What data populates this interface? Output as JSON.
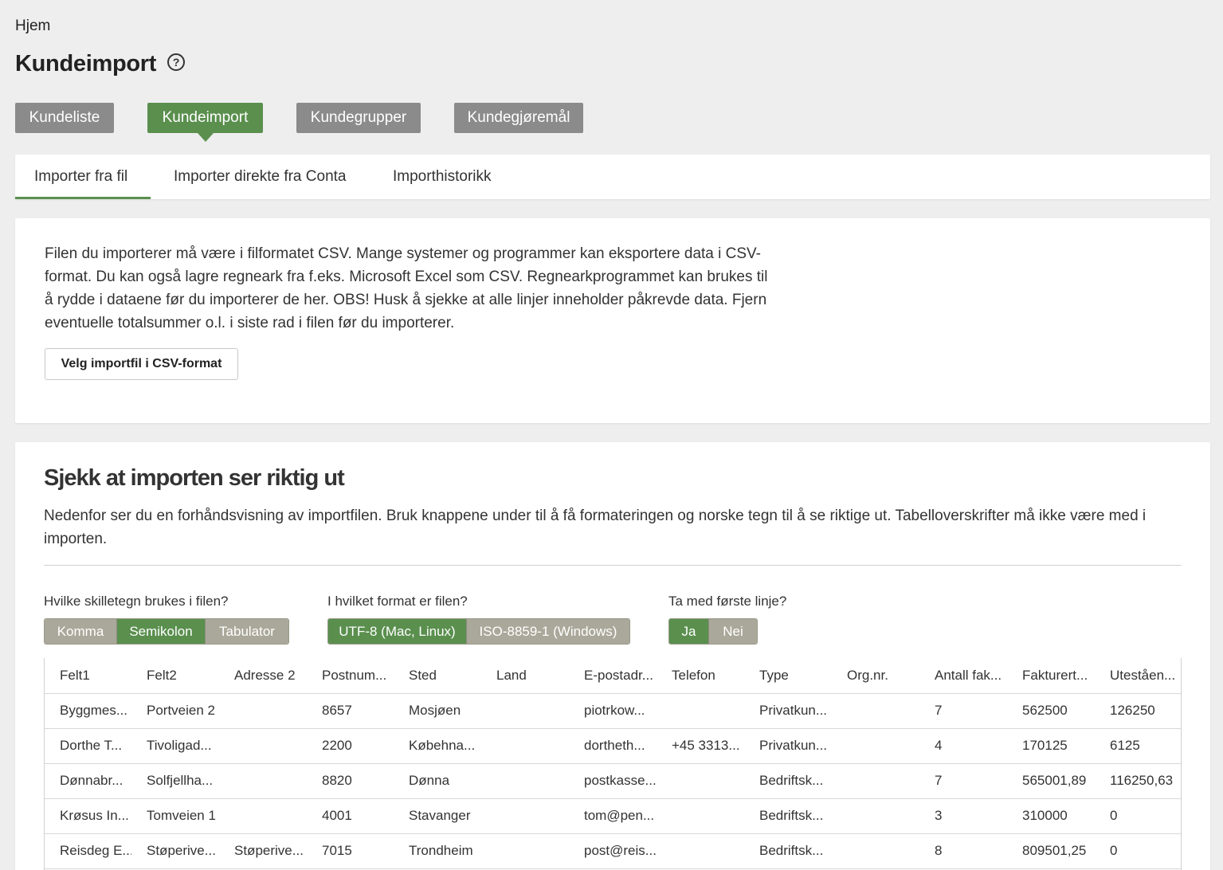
{
  "breadcrumb": "Hjem",
  "page_title": "Kundeimport",
  "help_glyph": "?",
  "main_nav": [
    "Kundeliste",
    "Kundeimport",
    "Kundegrupper",
    "Kundegjøremål"
  ],
  "sub_tabs": [
    "Importer fra fil",
    "Importer direkte fra Conta",
    "Importhistorikk"
  ],
  "intro": {
    "text": "Filen du importerer må være i filformatet CSV. Mange systemer og programmer kan eksportere data i CSV-format. Du kan også lagre regneark fra f.eks. Microsoft Excel som CSV. Regnearkprogrammet kan brukes til å rydde i dataene før du importerer de her. OBS! Husk å sjekke at alle linjer inneholder påkrevde data. Fjern eventuelle totalsummer o.l. i siste rad i filen før du importerer.",
    "button": "Velg importfil i CSV-format"
  },
  "preview": {
    "title": "Sjekk at importen ser riktig ut",
    "description": "Nedenfor ser du en forhåndsvisning av importfilen. Bruk knappene under til å få formateringen og norske tegn til å se riktige ut. Tabelloverskrifter må ikke være med i importen.",
    "separator_label": "Hvilke skilletegn brukes i filen?",
    "separator_options": [
      "Komma",
      "Semikolon",
      "Tabulator"
    ],
    "separator_selected": "Semikolon",
    "format_label": "I hvilket format er filen?",
    "format_options": [
      "UTF-8 (Mac, Linux)",
      "ISO-8859-1 (Windows)"
    ],
    "format_selected": "UTF-8 (Mac, Linux)",
    "first_line_label": "Ta med første linje?",
    "first_line_options": [
      "Ja",
      "Nei"
    ],
    "first_line_selected": "Ja",
    "columns": [
      "Felt1",
      "Felt2",
      "Adresse 2",
      "Postnum...",
      "Sted",
      "Land",
      "E-postadr...",
      "Telefon",
      "Type",
      "Org.nr.",
      "Antall fak...",
      "Fakturert...",
      "Uteståen..."
    ],
    "rows": [
      [
        "Byggmes...",
        "Portveien 2",
        "",
        "8657",
        "Mosjøen",
        "",
        "piotrkow...",
        "",
        "Privatkun...",
        "",
        "7",
        "562500",
        "126250"
      ],
      [
        "Dorthe T...",
        "Tivoligad...",
        "",
        "2200",
        "Købehna...",
        "",
        "dortheth...",
        "+45 3313...",
        "Privatkun...",
        "",
        "4",
        "170125",
        "6125"
      ],
      [
        "Dønnabr...",
        "Solfjellha...",
        "",
        "8820",
        "Dønna",
        "",
        "postkasse...",
        "",
        "Bedriftsk...",
        "",
        "7",
        "565001,89",
        "116250,63"
      ],
      [
        "Krøsus In...",
        "Tomveien 1",
        "",
        "4001",
        "Stavanger",
        "",
        "tom@pen...",
        "",
        "Bedriftsk...",
        "",
        "3",
        "310000",
        "0"
      ],
      [
        "Reisdeg E...",
        "Støperive...",
        "Støperive...",
        "7015",
        "Trondheim",
        "",
        "post@reis...",
        "",
        "Bedriftsk...",
        "",
        "8",
        "809501,25",
        "0"
      ]
    ]
  },
  "colors": {
    "accent": "#5a8f4e",
    "nav_inactive": "#8b8b8b",
    "segment_inactive": "#aaa89a"
  }
}
